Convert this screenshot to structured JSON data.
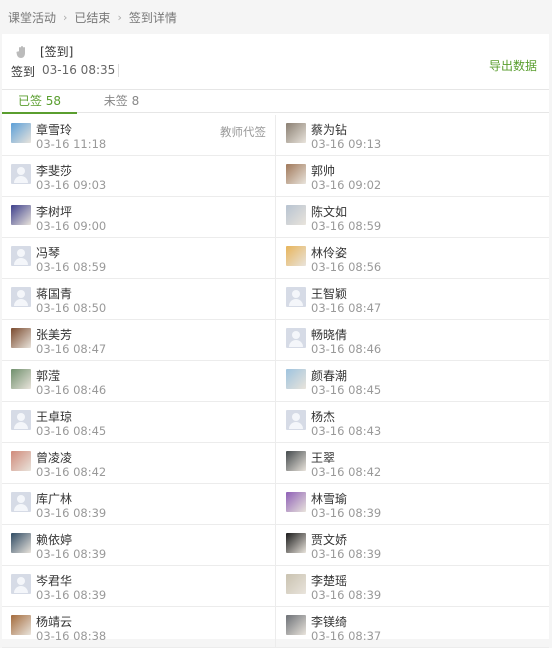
{
  "breadcrumb": [
    "课堂活动",
    "已结束",
    "签到详情"
  ],
  "header": {
    "title": "[签到]",
    "type_label": "签到",
    "time": "03-16 08:35",
    "export_label": "导出数据"
  },
  "tabs": [
    {
      "label": "已签 58",
      "active": true
    },
    {
      "label": "未签 8",
      "active": false
    }
  ],
  "students": [
    {
      "name": "章雪玲",
      "time": "03-16 11:18",
      "avatar": "photo",
      "color": "#5b9fd8",
      "tag": "教师代签"
    },
    {
      "name": "蔡为钻",
      "time": "03-16 09:13",
      "avatar": "photo",
      "color": "#8a7f72"
    },
    {
      "name": "李斐莎",
      "time": "03-16 09:03",
      "avatar": "default"
    },
    {
      "name": "郭帅",
      "time": "03-16 09:02",
      "avatar": "photo",
      "color": "#a0785a"
    },
    {
      "name": "李树坪",
      "time": "03-16 09:00",
      "avatar": "photo",
      "color": "#3d3f8c"
    },
    {
      "name": "陈文如",
      "time": "03-16 08:59",
      "avatar": "photo",
      "color": "#b7c3d1"
    },
    {
      "name": "冯琴",
      "time": "03-16 08:59",
      "avatar": "default"
    },
    {
      "name": "林伶姿",
      "time": "03-16 08:56",
      "avatar": "photo",
      "color": "#e7b45a"
    },
    {
      "name": "蒋国青",
      "time": "03-16 08:50",
      "avatar": "default"
    },
    {
      "name": "王智颖",
      "time": "03-16 08:47",
      "avatar": "default"
    },
    {
      "name": "张美芳",
      "time": "03-16 08:47",
      "avatar": "photo",
      "color": "#7a4a2e"
    },
    {
      "name": "畅晓倩",
      "time": "03-16 08:46",
      "avatar": "default"
    },
    {
      "name": "郭滢",
      "time": "03-16 08:46",
      "avatar": "photo",
      "color": "#6f8f6c"
    },
    {
      "name": "颜春潮",
      "time": "03-16 08:45",
      "avatar": "photo",
      "color": "#9ec3de"
    },
    {
      "name": "王卓琼",
      "time": "03-16 08:45",
      "avatar": "default"
    },
    {
      "name": "杨杰",
      "time": "03-16 08:43",
      "avatar": "default"
    },
    {
      "name": "曾凌凌",
      "time": "03-16 08:42",
      "avatar": "photo",
      "color": "#d08a7a"
    },
    {
      "name": "王翠",
      "time": "03-16 08:42",
      "avatar": "photo",
      "color": "#444a4d"
    },
    {
      "name": "库广林",
      "time": "03-16 08:39",
      "avatar": "default"
    },
    {
      "name": "林雪瑜",
      "time": "03-16 08:39",
      "avatar": "photo",
      "color": "#8e5fb6"
    },
    {
      "name": "赖依婷",
      "time": "03-16 08:39",
      "avatar": "photo",
      "color": "#2e4a63"
    },
    {
      "name": "贾文娇",
      "time": "03-16 08:39",
      "avatar": "photo",
      "color": "#1a1a1a"
    },
    {
      "name": "岑君华",
      "time": "03-16 08:39",
      "avatar": "default"
    },
    {
      "name": "李楚瑶",
      "time": "03-16 08:39",
      "avatar": "photo",
      "color": "#c9c2b0"
    },
    {
      "name": "杨靖云",
      "time": "03-16 08:38",
      "avatar": "photo",
      "color": "#a46a3b"
    },
    {
      "name": "李镁绮",
      "time": "03-16 08:37",
      "avatar": "photo",
      "color": "#6c7076"
    }
  ]
}
